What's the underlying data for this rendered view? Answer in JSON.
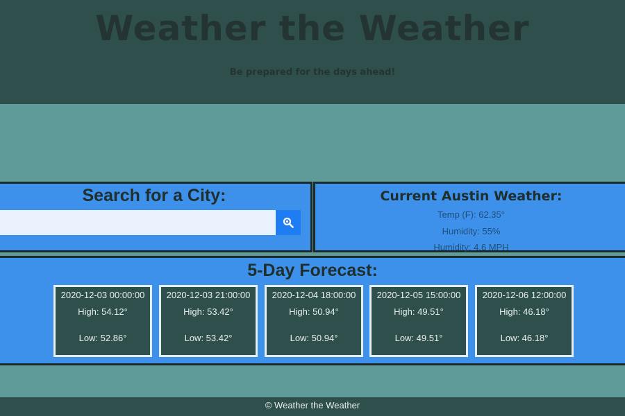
{
  "hero": {
    "title": "Weather the Weather",
    "tagline": "Be prepared for the days ahead!"
  },
  "search": {
    "title": "Search for a City:",
    "input_value": "",
    "placeholder": "",
    "button_icon": "search-icon"
  },
  "current": {
    "title": "Current Austin Weather:",
    "temp": "Temp (F): 62.35°",
    "humidity": "Humidity: 55%",
    "wind": "Humidity: 4.6 MPH"
  },
  "forecast": {
    "title": "5-Day Forecast:",
    "days": [
      {
        "date": "2020-12-03 00:00:00",
        "high": "High: 54.12°",
        "low": "Low: 52.86°"
      },
      {
        "date": "2020-12-03 21:00:00",
        "high": "High: 53.42°",
        "low": "Low: 53.42°"
      },
      {
        "date": "2020-12-04 18:00:00",
        "high": "High: 50.94°",
        "low": "Low: 50.94°"
      },
      {
        "date": "2020-12-05 15:00:00",
        "high": "High: 49.51°",
        "low": "Low: 49.51°"
      },
      {
        "date": "2020-12-06 12:00:00",
        "high": "High: 46.18°",
        "low": "Low: 46.18°"
      }
    ]
  },
  "footer": {
    "text": "© Weather the Weather"
  },
  "colors": {
    "header_bg": "#2f4f4d",
    "page_bg": "#5f9b99",
    "panel_bg": "#3d91ea",
    "button_bg": "#1e7df2"
  }
}
